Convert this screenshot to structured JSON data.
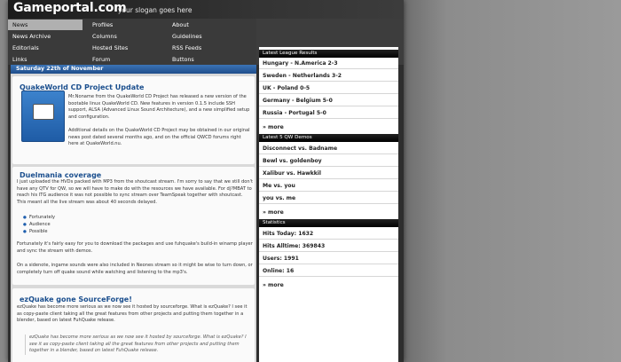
{
  "header": {
    "logo": "Gameportal.com",
    "slogan": "your slogan goes here"
  },
  "nav": {
    "rows": [
      [
        "News",
        "Profiles",
        "About"
      ],
      [
        "News Archive",
        "Columns",
        "Guidelines"
      ],
      [
        "Editorials",
        "Hosted Sites",
        "RSS Feeds"
      ],
      [
        "Links",
        "Forum",
        "Buttons"
      ]
    ],
    "active": "News"
  },
  "main": {
    "date": "Saturday 22th of November",
    "articles": [
      {
        "title": "QuakeWorld CD Project Update",
        "p1": "Mr.Noname from the QuakeWorld CD Project has released a new version of the bootable linux QuakeWorld CD. New features in version 0.1.5 include SSH support, ALSA (Advanced Linux Sound Architecture), and a new simplified setup and configuration.",
        "p2": "Additional details on the QuakeWorld CD Project may be obtained in our original news post dated several months ago, and on the official QWCD forums right here at QuakeWorld.nu."
      },
      {
        "title": "Duelmania coverage",
        "p1": "I just uploaded the HVDs packed with MP3 from the shoutcast stream. I'm sorry to say that we still don't have any QTV for QW, so we will have to make do with the resources we have available. For dj?MBAT to reach his ITG audience it was not possible to sync stream over TeamSpeak together with shoutcast. This meant all the live stream was about 40 seconds delayed.",
        "bullets": [
          "Fortunately",
          "Audience",
          "Possible"
        ],
        "p2": "Fortunately it's fairly easy for you to download the packages and use fuhquake's build-in winamp player and sync the stream with demos.",
        "p3": "On a sidenote, ingame sounds were also included in Neones stream so it might be wise to turn down, or completely turn off quake sound while watching and listening to the mp3's."
      },
      {
        "title": "ezQuake gone SourceForge!",
        "p1": "ezQuake has become more serious as we now see it hosted by sourceforge. What is ezQuake? I see it as copy-paste client taking all the great features from other projects and putting them together in a blender, based on latest FuhQuake release.",
        "quote": "ezQuake has become more serious as we now see it hosted by sourceforge. What is ezQuake? I see it as copy-paste client taking all the great features from other projects and putting them together in a blender, based on latest FuhQuake release."
      }
    ]
  },
  "sidebar": {
    "league": {
      "title": "Latest League Results",
      "items": [
        "Hungary - N.America 2-3",
        "Sweden - Netherlands 3-2",
        "UK - Poland 0-5",
        "Germany - Belgium 5-0",
        "Russia - Portugal 5-0"
      ],
      "more": "» more"
    },
    "demos": {
      "title": "Latest 5 QW Demos",
      "items": [
        "Disconnect vs. Badname",
        "Bewl vs. goldenboy",
        "Xalibur vs. Hawkkil",
        "Me vs. you",
        "you vs. me"
      ],
      "more": "» more"
    },
    "stats": {
      "title": "Statistics",
      "items": [
        "Hits Today: 1632",
        "Hits Alltime: 369843",
        "Users: 1991",
        "Online: 16"
      ],
      "more": "» more"
    }
  }
}
